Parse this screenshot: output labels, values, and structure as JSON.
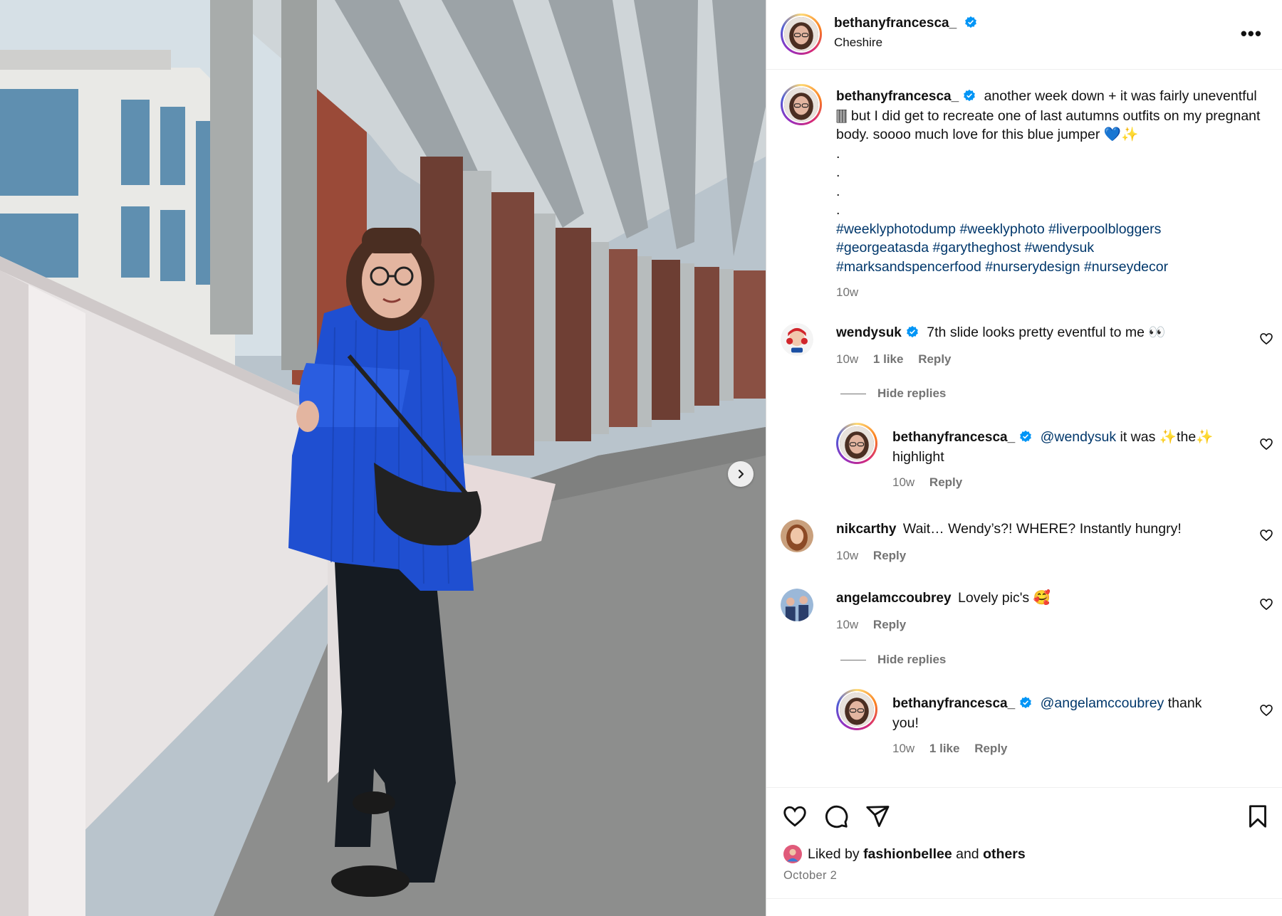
{
  "post": {
    "username": "bethanyfrancesca_",
    "location": "Cheshire",
    "more_label": "•••",
    "caption_text": "another week down + it was fairly uneventful 🀫 but I did get to recreate one of last autumns outfits on my pregnant body. soooo much love for this blue jumper 💙✨",
    "caption_dots": [
      ".",
      ".",
      ".",
      "."
    ],
    "hashtags_line1": "#weeklyphotodump #weeklyphoto #liverpoolbloggers",
    "hashtags_line2": "#georgeatasda #garytheghost #wendysuk",
    "hashtags_line3": "#marksandspencerfood #nurserydesign #nurseydecor",
    "caption_time": "10w",
    "liked_by_prefix": "Liked by",
    "liked_by_user": "fashionbellee",
    "liked_by_and": "and",
    "liked_by_others": "others",
    "date": "October 2"
  },
  "comments": [
    {
      "username": "wendysuk",
      "text": "7th slide looks pretty eventful to me 👀",
      "time": "10w",
      "likes": "1 like",
      "reply_label": "Reply",
      "hide_replies": "Hide replies",
      "reply": {
        "username": "bethanyfrancesca_",
        "mention": "@wendysuk",
        "text_line1": "it was ✨the✨",
        "text_line2": "highlight",
        "time": "10w",
        "reply_label": "Reply"
      }
    },
    {
      "username": "nikcarthy",
      "text": "Wait… Wendy’s?! WHERE? Instantly hungry!",
      "time": "10w",
      "reply_label": "Reply"
    },
    {
      "username": "angelamccoubrey",
      "text": "Lovely pic's 🥰",
      "time": "10w",
      "reply_label": "Reply",
      "hide_replies": "Hide replies",
      "reply": {
        "username": "bethanyfrancesca_",
        "mention": "@angelamccoubrey",
        "text_line1": "thank",
        "text_line2": "you!",
        "time": "10w",
        "likes": "1 like",
        "reply_label": "Reply"
      }
    }
  ],
  "colors": {
    "verified": "#0095f6",
    "hashtag": "#00376b",
    "meta": "#737373",
    "jumper": "#1f4fd1"
  },
  "icons": [
    "verified-badge-icon",
    "more-options-icon",
    "heart-icon",
    "comment-icon",
    "share-icon",
    "bookmark-icon",
    "chevron-right-icon"
  ]
}
